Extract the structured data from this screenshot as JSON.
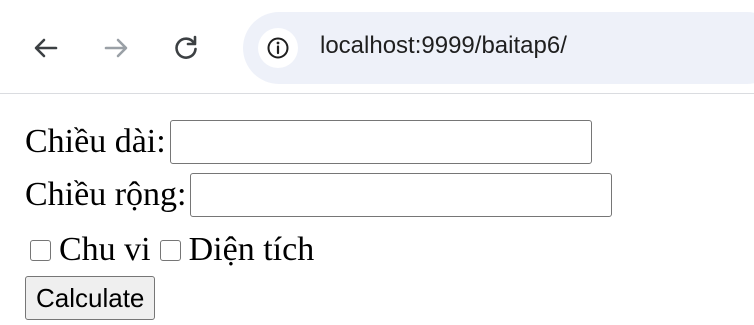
{
  "browser": {
    "url": "localhost:9999/baitap6/",
    "icons": {
      "back": "arrow-left-icon",
      "forward": "arrow-right-icon",
      "reload": "reload-icon",
      "site_info": "info-icon"
    }
  },
  "form": {
    "length_label": "Chiều dài:",
    "length_value": "",
    "width_label": "Chiều rộng:",
    "width_value": "",
    "perimeter_label": "Chu vi",
    "perimeter_checked": false,
    "area_label": "Diện tích",
    "area_checked": false,
    "calculate_label": "Calculate"
  }
}
